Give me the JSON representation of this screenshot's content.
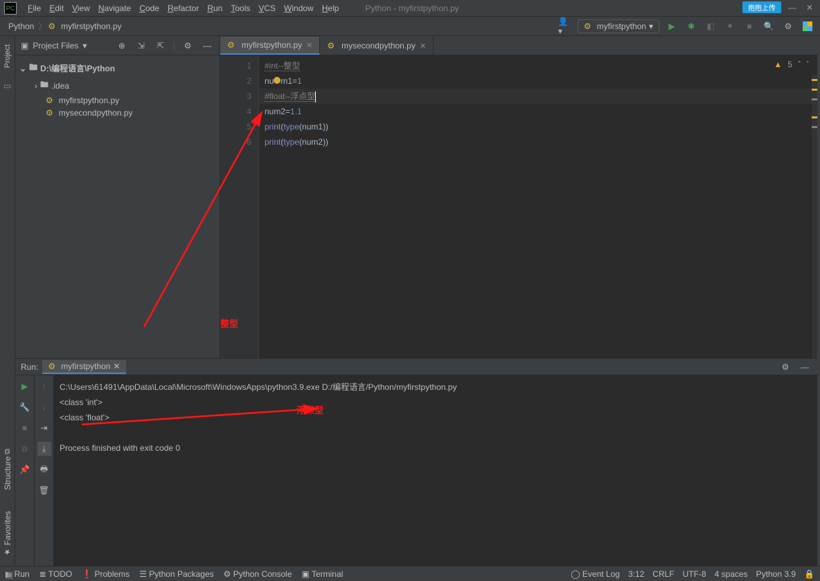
{
  "window": {
    "title": "Python - myfirstpython.py",
    "badge": "抱抱上传"
  },
  "menu": {
    "items": [
      "File",
      "Edit",
      "View",
      "Navigate",
      "Code",
      "Refactor",
      "Run",
      "Tools",
      "VCS",
      "Window",
      "Help"
    ]
  },
  "breadcrumb": {
    "root": "Python",
    "file": "myfirstpython.py"
  },
  "run_config": {
    "name": "myfirstpython"
  },
  "project_panel": {
    "title": "Project Files",
    "root": "D:\\编程语言\\Python",
    "children": [
      {
        "name": ".idea",
        "type": "folder"
      },
      {
        "name": "myfirstpython.py",
        "type": "py"
      },
      {
        "name": "mysecondpython.py",
        "type": "py"
      }
    ]
  },
  "tabs": [
    {
      "label": "myfirstpython.py",
      "active": true
    },
    {
      "label": "mysecondpython.py",
      "active": false
    }
  ],
  "editor": {
    "problems_count": "5",
    "lines": [
      {
        "n": "1",
        "tokens": [
          [
            "comment",
            "#int--整型"
          ]
        ]
      },
      {
        "n": "2",
        "tokens": [
          [
            "id",
            "n"
          ],
          [
            "warnid",
            "um"
          ],
          [
            "id",
            "1"
          ],
          [
            "op",
            "="
          ],
          [
            "num",
            "1"
          ]
        ]
      },
      {
        "n": "3",
        "hl": true,
        "tokens": [
          [
            "comment",
            "#float--浮点型"
          ],
          [
            "caret",
            ""
          ]
        ]
      },
      {
        "n": "4",
        "tokens": [
          [
            "id",
            "num2"
          ],
          [
            "op",
            "="
          ],
          [
            "num",
            "1.1"
          ]
        ]
      },
      {
        "n": "5",
        "tokens": [
          [
            "builtin",
            "print"
          ],
          [
            "p",
            "("
          ],
          [
            "builtin",
            "type"
          ],
          [
            "p",
            "("
          ],
          [
            "id",
            "num1"
          ],
          [
            "p",
            "))"
          ]
        ]
      },
      {
        "n": "6",
        "tokens": [
          [
            "builtin",
            "print"
          ],
          [
            "p",
            "("
          ],
          [
            "builtin",
            "type"
          ],
          [
            "p",
            "("
          ],
          [
            "id",
            "num2"
          ],
          [
            "p",
            "))"
          ]
        ]
      }
    ]
  },
  "annotations": {
    "int_label": "整型",
    "float_label": "浮点型"
  },
  "run_tool": {
    "title": "Run:",
    "tab": "myfirstpython",
    "lines": [
      "C:\\Users\\61491\\AppData\\Local\\Microsoft\\WindowsApps\\python3.9.exe D:/编程语言/Python/myfirstpython.py",
      "<class 'int'>",
      "<class 'float'>",
      "",
      "Process finished with exit code 0"
    ]
  },
  "sidebar_tabs": {
    "project": "Project",
    "structure": "Structure",
    "favorites": "Favorites"
  },
  "bottom_tabs": {
    "run": "Run",
    "todo": "TODO",
    "problems": "Problems",
    "pypkg": "Python Packages",
    "pyconsole": "Python Console",
    "terminal": "Terminal",
    "eventlog": "Event Log"
  },
  "status": {
    "pos": "3:12",
    "eol": "CRLF",
    "enc": "UTF-8",
    "indent": "4 spaces",
    "interp": "Python 3.9"
  }
}
